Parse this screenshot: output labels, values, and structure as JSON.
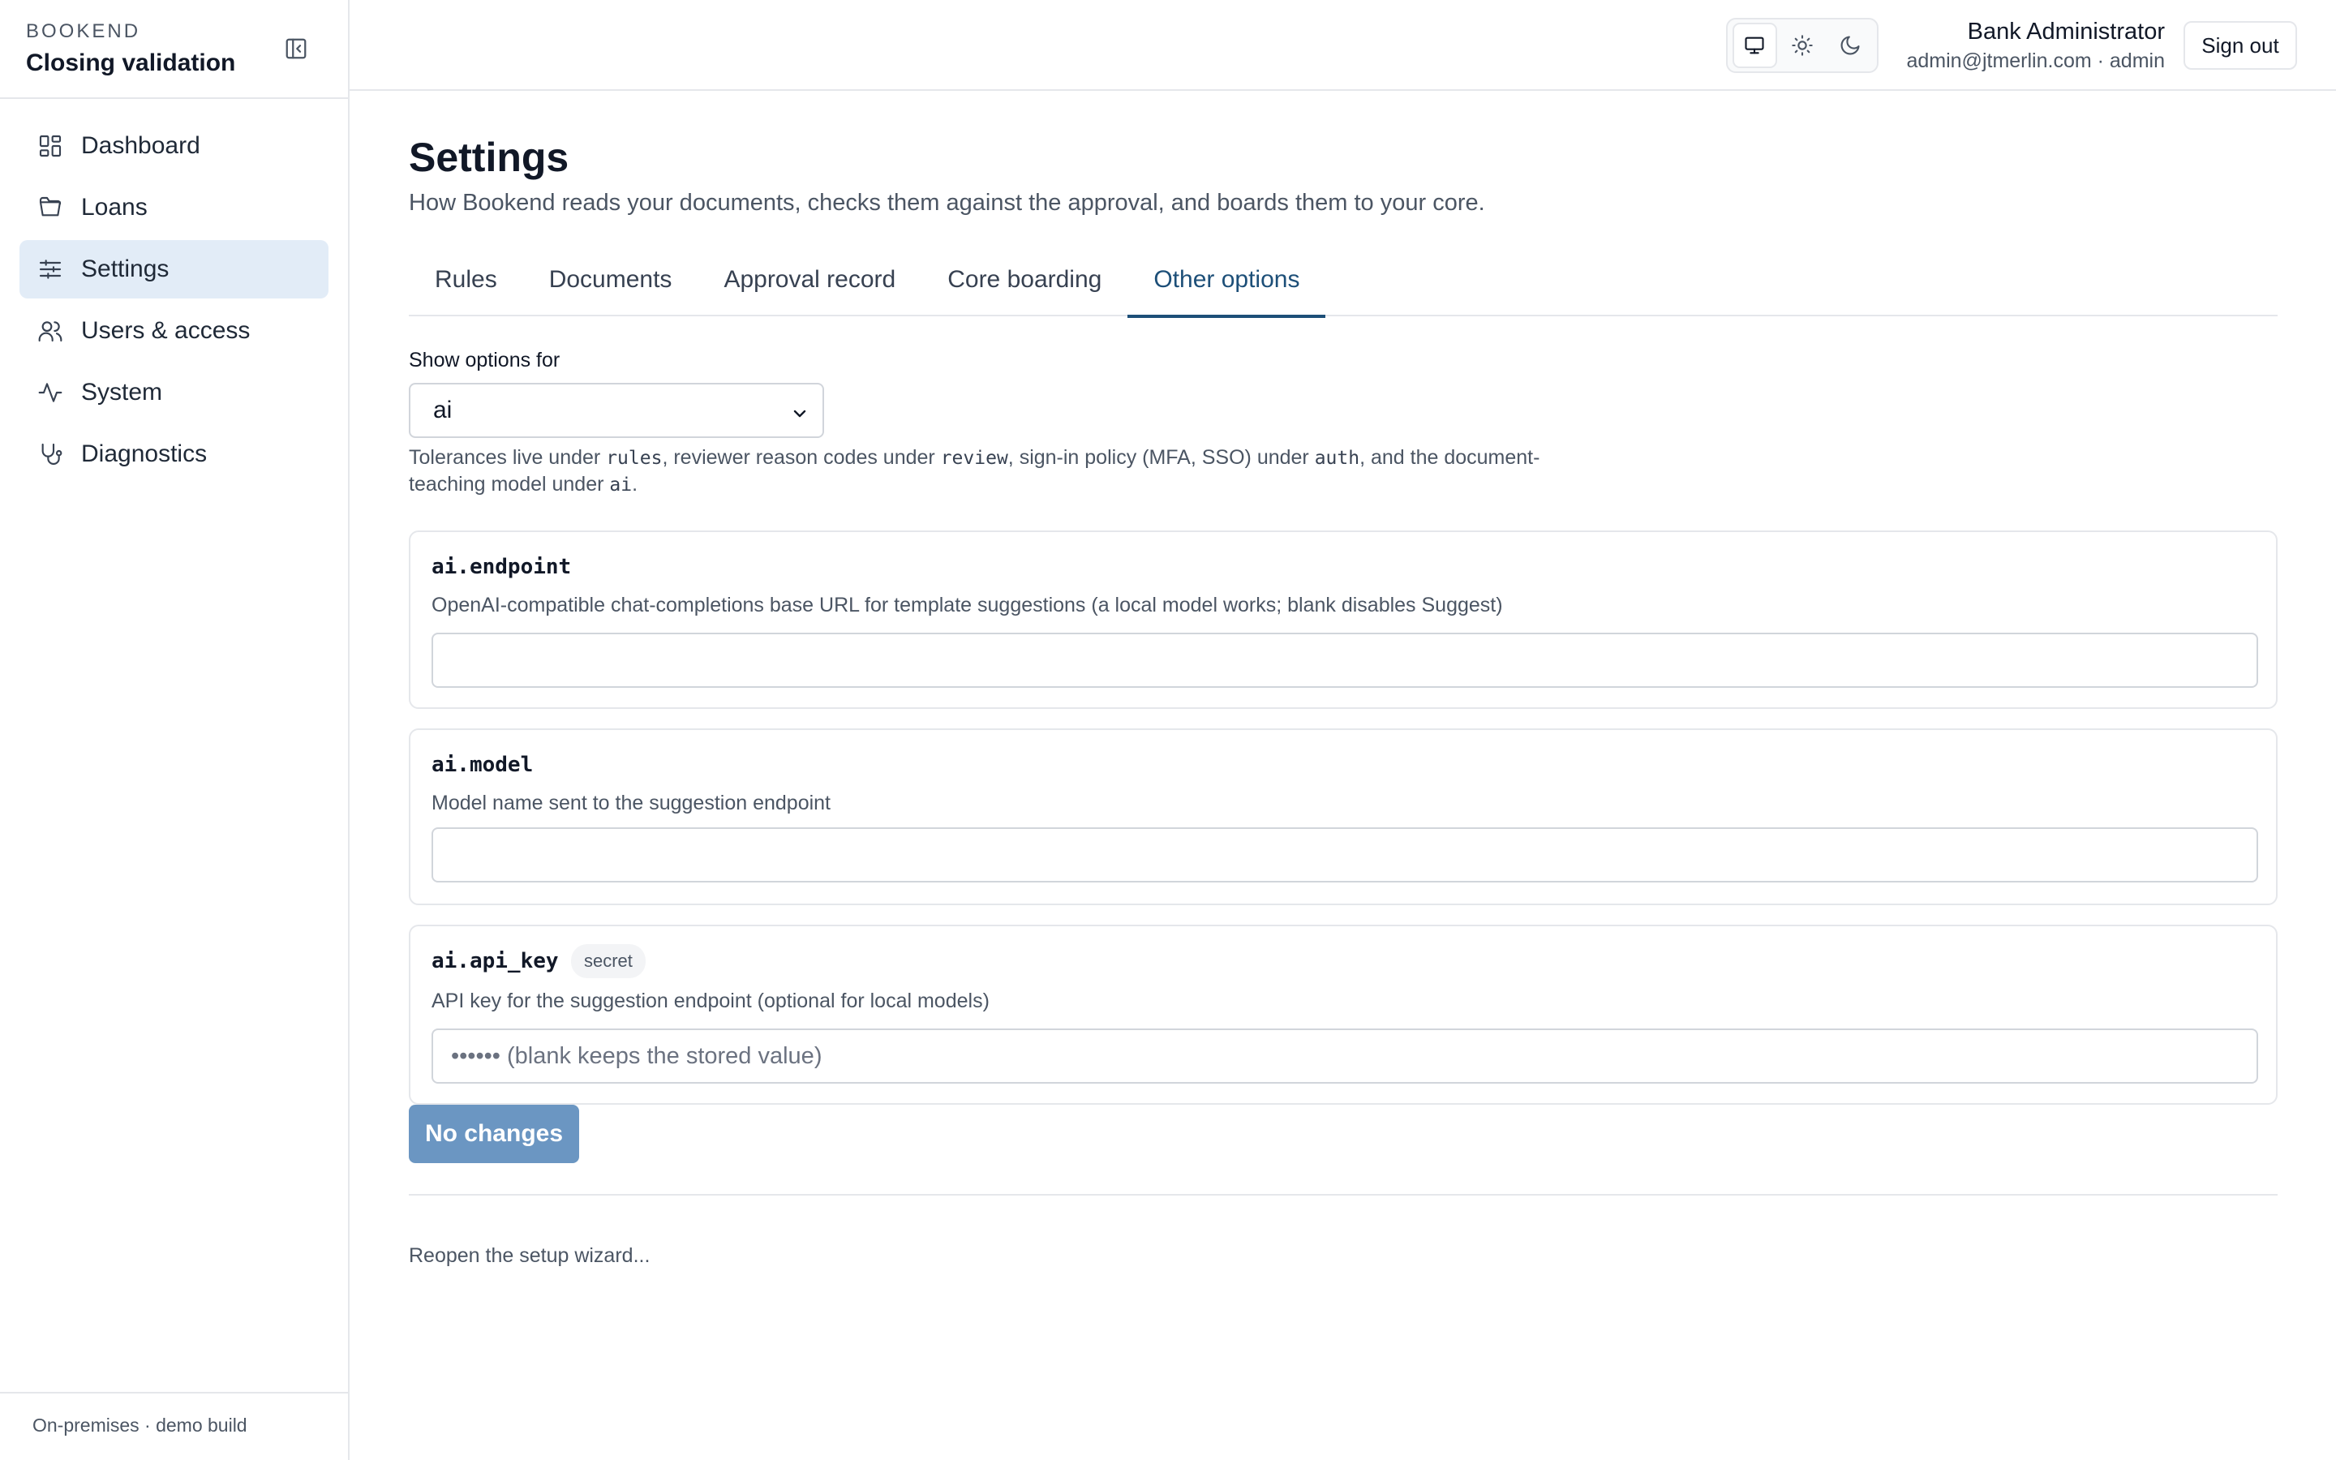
{
  "sidebar": {
    "brand_kicker": "BOOKEND",
    "brand_title": "Closing validation",
    "collapse_icon": "sidebar-collapse-icon",
    "items": [
      {
        "label": "Dashboard",
        "icon": "grid-icon"
      },
      {
        "label": "Loans",
        "icon": "folder-icon"
      },
      {
        "label": "Settings",
        "icon": "sliders-icon",
        "active": true
      },
      {
        "label": "Users & access",
        "icon": "users-icon"
      },
      {
        "label": "System",
        "icon": "activity-icon"
      },
      {
        "label": "Diagnostics",
        "icon": "stethoscope-icon"
      }
    ],
    "footer": "On-premises · demo build"
  },
  "header": {
    "theme_options": [
      "monitor-icon",
      "sun-icon",
      "moon-icon"
    ],
    "theme_selected": "monitor-icon",
    "user_name": "Bank Administrator",
    "user_meta": "admin@jtmerlin.com · admin",
    "signout_label": "Sign out"
  },
  "main": {
    "title": "Settings",
    "subtitle": "How Bookend reads your documents, checks them against the approval, and boards them to your core.",
    "tabs": [
      {
        "label": "Rules"
      },
      {
        "label": "Documents"
      },
      {
        "label": "Approval record"
      },
      {
        "label": "Core boarding"
      },
      {
        "label": "Other options",
        "active": true
      }
    ],
    "select_label": "Show options for",
    "select_value": "ai",
    "hint": {
      "p1": "Tolerances live under ",
      "c1": "rules",
      "p2": ", reviewer reason codes under ",
      "c2": "review",
      "p3": ", sign-in policy (MFA, SSO) under ",
      "c3": "auth",
      "p4": ", and the document-teaching model under ",
      "c4": "ai",
      "p5": "."
    },
    "settings": [
      {
        "key": "ai.endpoint",
        "description": "OpenAI-compatible chat-completions base URL for template suggestions (a local model works; blank disables Suggest)",
        "value": "",
        "placeholder": ""
      },
      {
        "key": "ai.model",
        "description": "Model name sent to the suggestion endpoint",
        "value": "",
        "placeholder": ""
      },
      {
        "key": "ai.api_key",
        "badge": "secret",
        "description": "API key for the suggestion endpoint (optional for local models)",
        "value": "",
        "placeholder": "•••••• (blank keeps the stored value)"
      }
    ],
    "save_label": "No changes",
    "wizard_link": "Reopen the setup wizard..."
  },
  "colors": {
    "accent": "#1d4f78",
    "active_nav_bg": "#e2ecf7",
    "disabled_button": "#6b96c2",
    "border": "#e5e7eb"
  }
}
